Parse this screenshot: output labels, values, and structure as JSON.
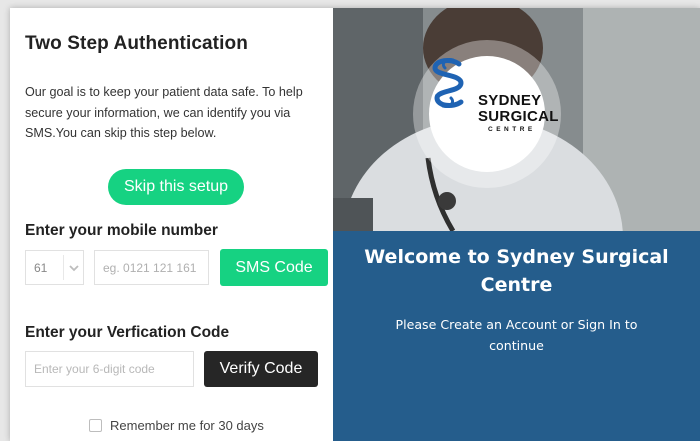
{
  "auth": {
    "title": "Two Step Authentication",
    "intro": "Our goal is to keep your patient data safe. To help secure your information, we can identify you via SMS.You can skip this step below.",
    "skip_label": "Skip this setup",
    "mobile_label": "Enter your mobile number",
    "country_code": "61",
    "phone_placeholder": "eg. 0121 121 161",
    "sms_button": "SMS Code",
    "verify_label": "Enter your Verfication Code",
    "code_placeholder": "Enter your 6-digit code",
    "verify_button": "Verify Code",
    "remember_label": "Remember me for 30 days",
    "remember_checked": false
  },
  "brand": {
    "logo_line1": "SYDNEY",
    "logo_line2": "SURGICAL",
    "logo_line3": "CENTRE",
    "welcome": "Welcome to Sydney Surgical Centre",
    "subtitle": "Please Create an Account or Sign In to continue"
  },
  "colors": {
    "accent_green": "#16d282",
    "dark_button": "#262626",
    "panel_blue": "#255d8c",
    "logo_blue": "#1f63b3"
  },
  "icons": {
    "country_dropdown": "chevron-down-icon",
    "logo_mark": "s-helix-logo-icon"
  }
}
